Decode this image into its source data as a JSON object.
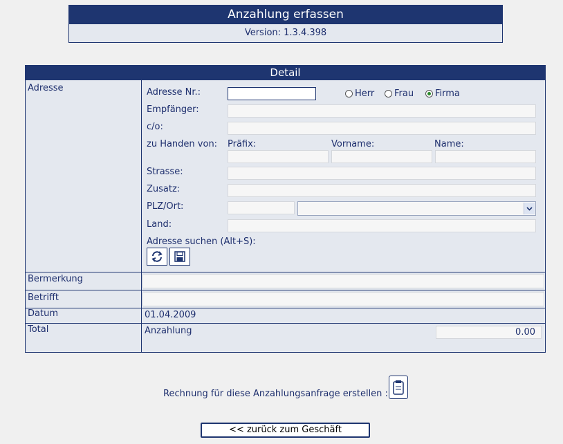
{
  "header": {
    "title": "Anzahlung erfassen",
    "version": "Version: 1.3.4.398"
  },
  "detail": {
    "title": "Detail",
    "sections": {
      "adresse": "Adresse",
      "bemerkung": "Bermerkung",
      "betrifft": "Betrifft",
      "datum": "Datum",
      "total": "Total"
    },
    "address_form": {
      "adresse_nr_label": "Adresse Nr.:",
      "adresse_nr_value": "",
      "salutation": {
        "options": [
          "Herr",
          "Frau",
          "Firma"
        ],
        "selected": "Firma"
      },
      "empfaenger_label": "Empfänger:",
      "co_label": "c/o:",
      "zu_handen_label": "zu Handen von:",
      "praefix_label": "Präfix:",
      "vorname_label": "Vorname:",
      "name_label": "Name:",
      "strasse_label": "Strasse:",
      "zusatz_label": "Zusatz:",
      "plz_ort_label": "PLZ/Ort:",
      "land_label": "Land:",
      "adresse_suchen_label": "Adresse suchen (Alt+S):"
    },
    "datum_value": "01.04.2009",
    "total_label": "Anzahlung",
    "total_value": "0.00"
  },
  "footer": {
    "rechnung_text": "Rechnung für diese Anzahlungsanfrage erstellen :",
    "back_button": "<<  zurück zum Geschäft"
  },
  "icons": [
    "refresh-icon",
    "save-icon",
    "notepad-icon",
    "chevron-down-icon"
  ]
}
